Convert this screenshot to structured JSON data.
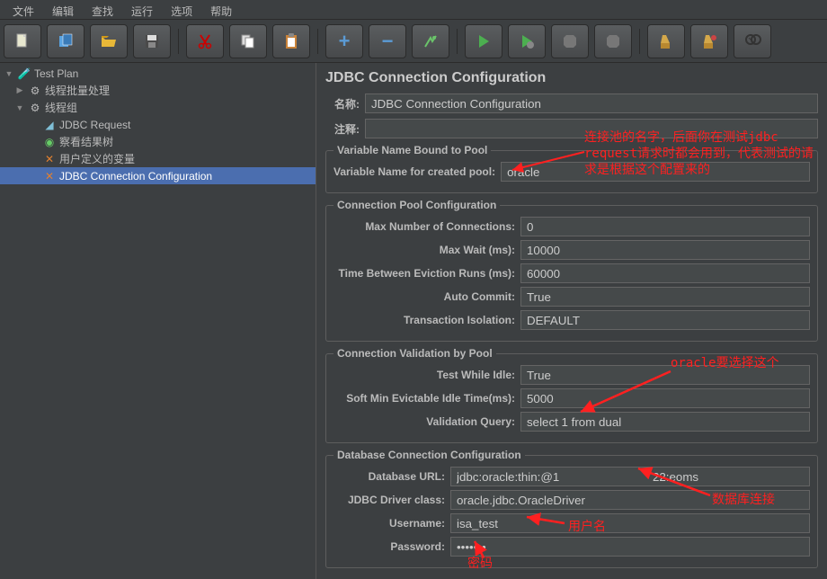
{
  "menu": {
    "file": "文件",
    "edit": "编辑",
    "search": "查找",
    "run": "运行",
    "options": "选项",
    "help": "帮助"
  },
  "tree": {
    "testplan": "Test Plan",
    "batch": "线程批量处理",
    "threadgroup": "线程组",
    "jdbcreq": "JDBC Request",
    "viewtree": "察看结果树",
    "uservars": "用户定义的变量",
    "jdbcconn": "JDBC Connection Configuration"
  },
  "panel": {
    "title": "JDBC Connection Configuration",
    "name_label": "名称:",
    "name_value": "JDBC Connection Configuration",
    "comment_label": "注释:",
    "comment_value": ""
  },
  "varbound": {
    "legend": "Variable Name Bound to Pool",
    "label": "Variable Name for created pool:",
    "value": "oracle"
  },
  "pool": {
    "legend": "Connection Pool Configuration",
    "maxconn_label": "Max Number of Connections:",
    "maxconn_value": "0",
    "maxwait_label": "Max Wait (ms):",
    "maxwait_value": "10000",
    "eviction_label": "Time Between Eviction Runs (ms):",
    "eviction_value": "60000",
    "autocommit_label": "Auto Commit:",
    "autocommit_value": "True",
    "isolation_label": "Transaction Isolation:",
    "isolation_value": "DEFAULT"
  },
  "validation": {
    "legend": "Connection Validation by Pool",
    "testidle_label": "Test While Idle:",
    "testidle_value": "True",
    "softevict_label": "Soft Min Evictable Idle Time(ms):",
    "softevict_value": "5000",
    "query_label": "Validation Query:",
    "query_value": "select 1 from dual"
  },
  "db": {
    "legend": "Database Connection Configuration",
    "url_label": "Database URL:",
    "url_value": "jdbc:oracle:thin:@1                            22:eoms",
    "driver_label": "JDBC Driver class:",
    "driver_value": "oracle.jdbc.OracleDriver",
    "user_label": "Username:",
    "user_value": "isa_test",
    "pass_label": "Password:",
    "pass_value": "•••••••"
  },
  "annotations": {
    "pool_name": "连接池的名字，后面你在测试jdbc request请求时都会用到，代表测试的请求是根据这个配置来的",
    "oracle_select": "oracle要选择这个",
    "db_conn": "数据库连接",
    "username": "用户名",
    "password": "密码"
  }
}
